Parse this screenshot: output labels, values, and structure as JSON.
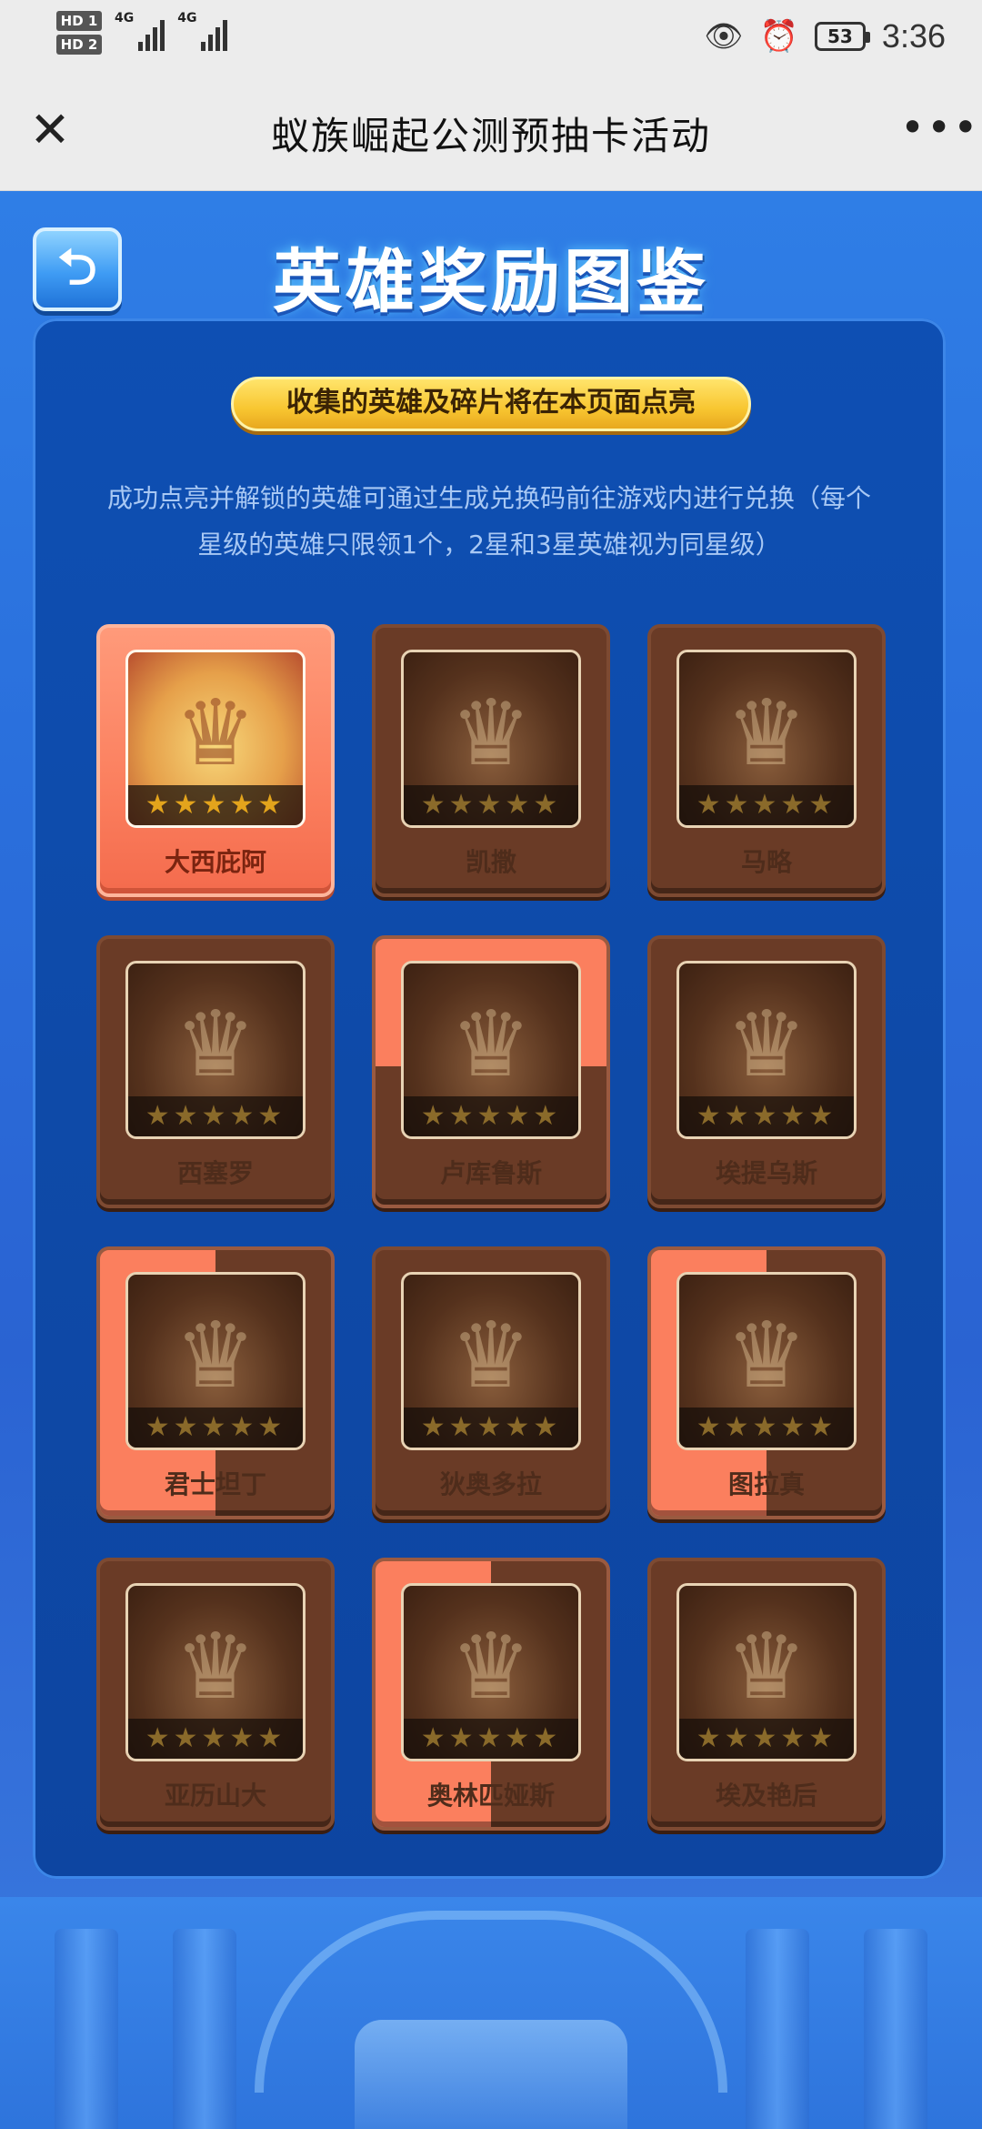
{
  "status_bar": {
    "sim1_tag": "HD 1",
    "sim2_tag": "HD 2",
    "sim1_net": "4G",
    "sim2_net": "4G",
    "eye_icon": "eye-icon",
    "alarm_icon": "alarm-icon",
    "battery_level": "53",
    "time": "3:36"
  },
  "titlebar": {
    "close_icon": "close-icon",
    "title": "蚁族崛起公测预抽卡活动",
    "more_icon": "more-icon"
  },
  "header": {
    "back_icon": "back-icon",
    "title": "英雄奖励图鉴"
  },
  "panel": {
    "pill_text": "收集的英雄及碎片将在本页面点亮",
    "description": "成功点亮并解锁的英雄可通过生成兑换码前往游戏内进行兑换（每个星级的英雄只限领1个，2星和3星英雄视为同星级）"
  },
  "heroes": [
    {
      "name": "大西庇阿",
      "stars": "★★★★★",
      "state": "lit"
    },
    {
      "name": "凯撒",
      "stars": "★★★★★",
      "state": "dim"
    },
    {
      "name": "马略",
      "stars": "★★★★★",
      "state": "dim"
    },
    {
      "name": "西塞罗",
      "stars": "★★★★★",
      "state": "dim"
    },
    {
      "name": "卢库鲁斯",
      "stars": "★★★★★",
      "state": "part"
    },
    {
      "name": "埃提乌斯",
      "stars": "★★★★★",
      "state": "dim"
    },
    {
      "name": "君士坦丁",
      "stars": "★★★★★",
      "state": "half"
    },
    {
      "name": "狄奥多拉",
      "stars": "★★★★★",
      "state": "dim"
    },
    {
      "name": "图拉真",
      "stars": "★★★★★",
      "state": "half"
    },
    {
      "name": "亚历山大",
      "stars": "★★★★★",
      "state": "dim"
    },
    {
      "name": "奥林匹娅斯",
      "stars": "★★★★★",
      "state": "half"
    },
    {
      "name": "埃及艳后",
      "stars": "★★★★★",
      "state": "dim"
    }
  ],
  "colors": {
    "lit_card": "#fb7f5e",
    "dim_card": "#6a3b26",
    "panel": "#0e4fb3",
    "pill": "#f8c631"
  }
}
